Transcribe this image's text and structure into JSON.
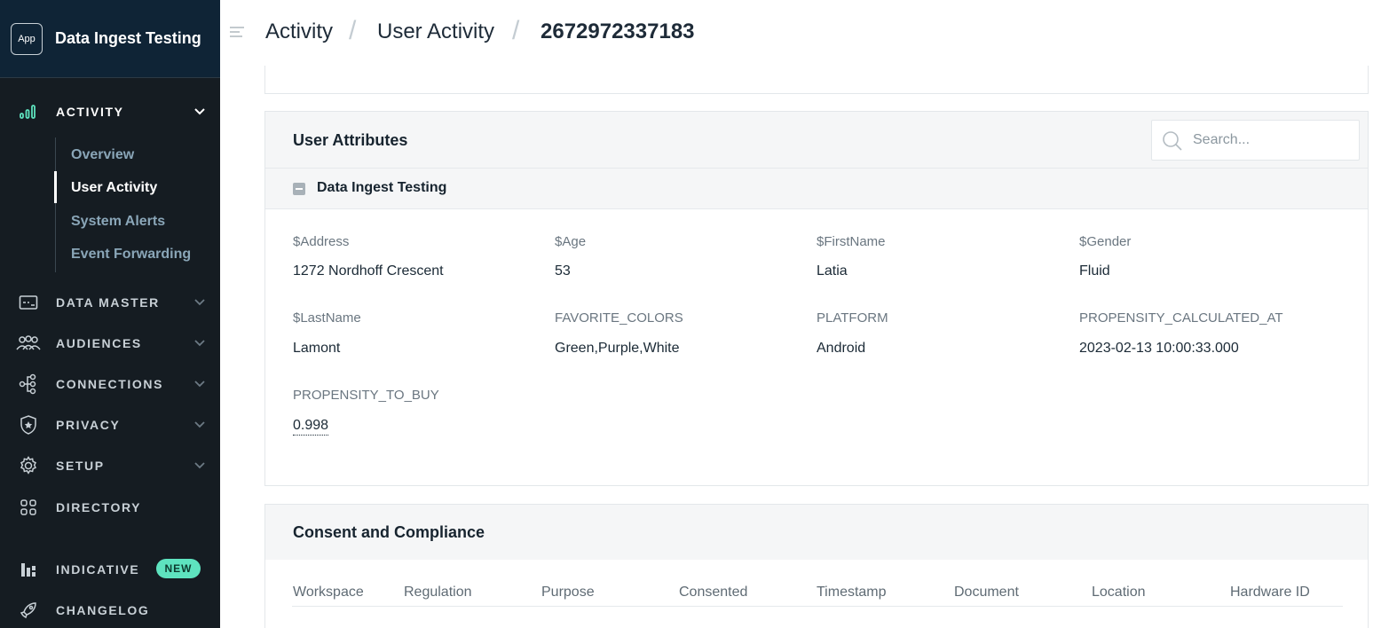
{
  "sidebar": {
    "app_badge": "App",
    "workspace_name": "Data Ingest Testing",
    "sections": {
      "activity": "ACTIVITY",
      "data_master": "DATA MASTER",
      "audiences": "AUDIENCES",
      "connections": "CONNECTIONS",
      "privacy": "PRIVACY",
      "setup": "SETUP",
      "directory": "DIRECTORY",
      "indicative": "INDICATIVE",
      "changelog": "CHANGELOG"
    },
    "new_badge": "NEW",
    "activity_items": [
      "Overview",
      "User Activity",
      "System Alerts",
      "Event Forwarding"
    ],
    "active_item": "User Activity"
  },
  "breadcrumb": [
    "Activity",
    "User Activity",
    "2672972337183"
  ],
  "user_attributes": {
    "title": "User Attributes",
    "search_placeholder": "Search...",
    "group_name": "Data Ingest Testing",
    "attributes": [
      {
        "label": "$Address",
        "value": "1272 Nordhoff Crescent"
      },
      {
        "label": "$Age",
        "value": "53"
      },
      {
        "label": "$FirstName",
        "value": "Latia"
      },
      {
        "label": "$Gender",
        "value": "Fluid"
      },
      {
        "label": "$LastName",
        "value": "Lamont"
      },
      {
        "label": "FAVORITE_COLORS",
        "value": "Green,Purple,White"
      },
      {
        "label": "PLATFORM",
        "value": "Android"
      },
      {
        "label": "PROPENSITY_CALCULATED_AT",
        "value": "2023-02-13 10:00:33.000"
      },
      {
        "label": "PROPENSITY_TO_BUY",
        "value": "0.998"
      }
    ]
  },
  "consent": {
    "title": "Consent and Compliance",
    "columns": [
      "Workspace",
      "Regulation",
      "Purpose",
      "Consented",
      "Timestamp",
      "Document",
      "Location",
      "Hardware ID"
    ]
  },
  "colors": {
    "sidebar_bg": "#151c22",
    "sidebar_header_bg": "#0f2436",
    "new_badge": "#5ee3bf",
    "card_header_bg": "#f5f6f7"
  }
}
